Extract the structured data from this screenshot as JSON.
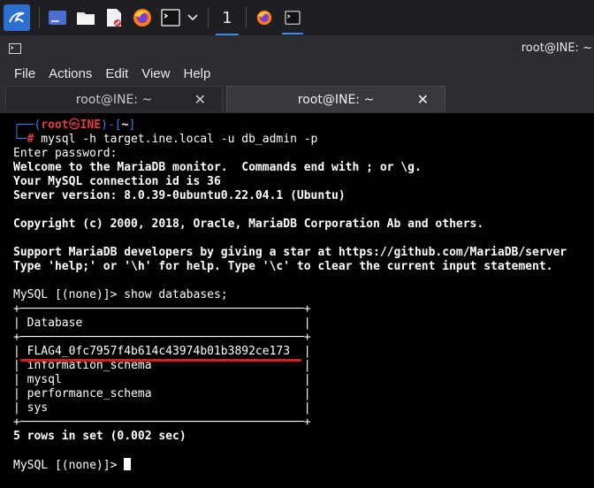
{
  "taskbar": {
    "workspace": "1",
    "icons": [
      "kali-menu-icon",
      "desktop-icon",
      "files-icon",
      "text-editor-icon",
      "firefox-icon",
      "terminal-icon",
      "chevron-down-icon",
      "firefox-icon",
      "terminal-icon"
    ]
  },
  "window": {
    "title": "root@INE: ~"
  },
  "menu": {
    "file": "File",
    "actions": "Actions",
    "edit": "Edit",
    "view": "View",
    "help": "Help"
  },
  "tabs": [
    {
      "label": "root@INE: ~",
      "close": "✕",
      "active": false
    },
    {
      "label": "root@INE: ~",
      "close": "✕",
      "active": true
    }
  ],
  "terminal": {
    "prompt": {
      "corner_top": "┌──(",
      "user": "root",
      "at": "㉿",
      "host": "INE",
      "mid": ")-[",
      "dir": "~",
      "close": "]",
      "corner_bottom": "└─",
      "hash": "#"
    },
    "command": " mysql -h target.ine.local -u db_admin -p",
    "lines": [
      "Enter password:",
      "Welcome to the MariaDB monitor.  Commands end with ; or \\g.",
      "Your MySQL connection id is 36",
      "Server version: 8.0.39-0ubuntu0.22.04.1 (Ubuntu)",
      "",
      "Copyright (c) 2000, 2018, Oracle, MariaDB Corporation Ab and others.",
      "",
      "Support MariaDB developers by giving a star at https://github.com/MariaDB/server",
      "Type 'help;' or '\\h' for help. Type '\\c' to clear the current input statement.",
      "",
      "MySQL [(none)]> show databases;",
      "+─────────────────────────────────────────+",
      "| Database                                |",
      "+─────────────────────────────────────────+",
      "| FLAG4_0fc7957f4b614c43974b01b3892ce173  |",
      "| information_schema                      |",
      "| mysql                                   |",
      "| performance_schema                      |",
      "| sys                                     |",
      "+─────────────────────────────────────────+",
      "5 rows in set (0.002 sec)",
      ""
    ],
    "final_prompt": "MySQL [(none)]> "
  },
  "colors": {
    "accent": "#3a8ee6",
    "prompt_blue": "#3a7be6",
    "prompt_red": "#e63a3a",
    "highlight_underline": "#d21f1f"
  }
}
